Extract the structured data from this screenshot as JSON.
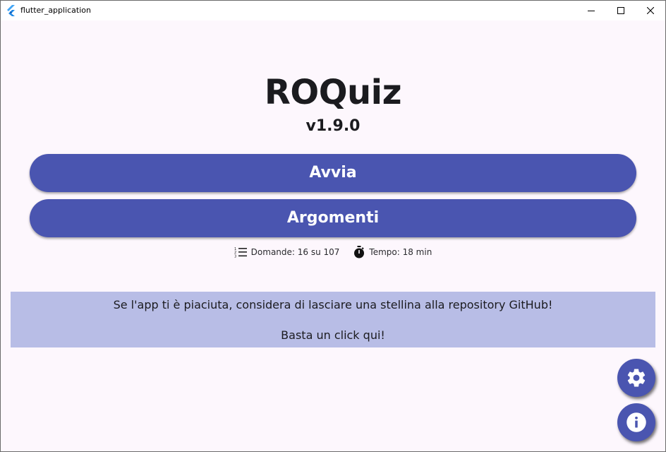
{
  "window": {
    "title": "flutter_application",
    "app_icon": "flutter-logo-icon",
    "controls": [
      "minimize-icon",
      "maximize-icon",
      "close-icon"
    ]
  },
  "main": {
    "title": "ROQuiz",
    "version": "v1.9.0",
    "start_button": "Avvia",
    "topics_button": "Argomenti",
    "questions_info": "Domande: 16 su 107",
    "questions_icon": "numbered-list-icon",
    "time_info": "Tempo: 18 min",
    "time_icon": "timer-icon"
  },
  "banner": {
    "line1": "Se l'app ti è piaciuta, considera di lasciare una stellina alla repository GitHub!",
    "line2": "Basta un click qui!"
  },
  "fabs": {
    "settings_icon": "gear-icon",
    "info_icon": "info-icon"
  },
  "colors": {
    "primary": "#4a55b0",
    "background": "#fdf7fd",
    "banner": "#b8bde6",
    "text": "#1b1b1f"
  }
}
